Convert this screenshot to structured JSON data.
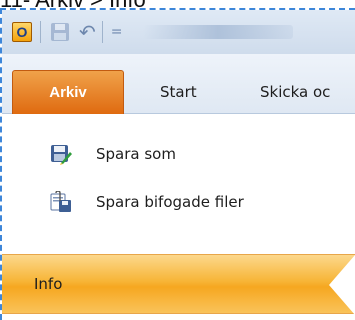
{
  "caption": "11- Arkiv > Info",
  "qat": {
    "app_icon_letter": "O",
    "app_icon": "outlook-icon",
    "save_icon": "save-icon",
    "undo_icon": "undo-icon",
    "undo_glyph": "↶",
    "customize_icon": "qat-dropdown-icon",
    "customize_glyph": "="
  },
  "ribbon": {
    "tabs": [
      {
        "label": "Arkiv"
      },
      {
        "label": "Start"
      },
      {
        "label": "Skicka oc"
      }
    ]
  },
  "backstage": {
    "items": [
      {
        "label": "Spara som",
        "icon": "save-as-icon"
      },
      {
        "label": "Spara bifogade filer",
        "icon": "save-attachments-icon"
      },
      {
        "label": "Info"
      }
    ]
  },
  "colors": {
    "file_tab": "#e07a1f",
    "selected_item": "#f7b537",
    "frame_border": "#3d86d9"
  }
}
